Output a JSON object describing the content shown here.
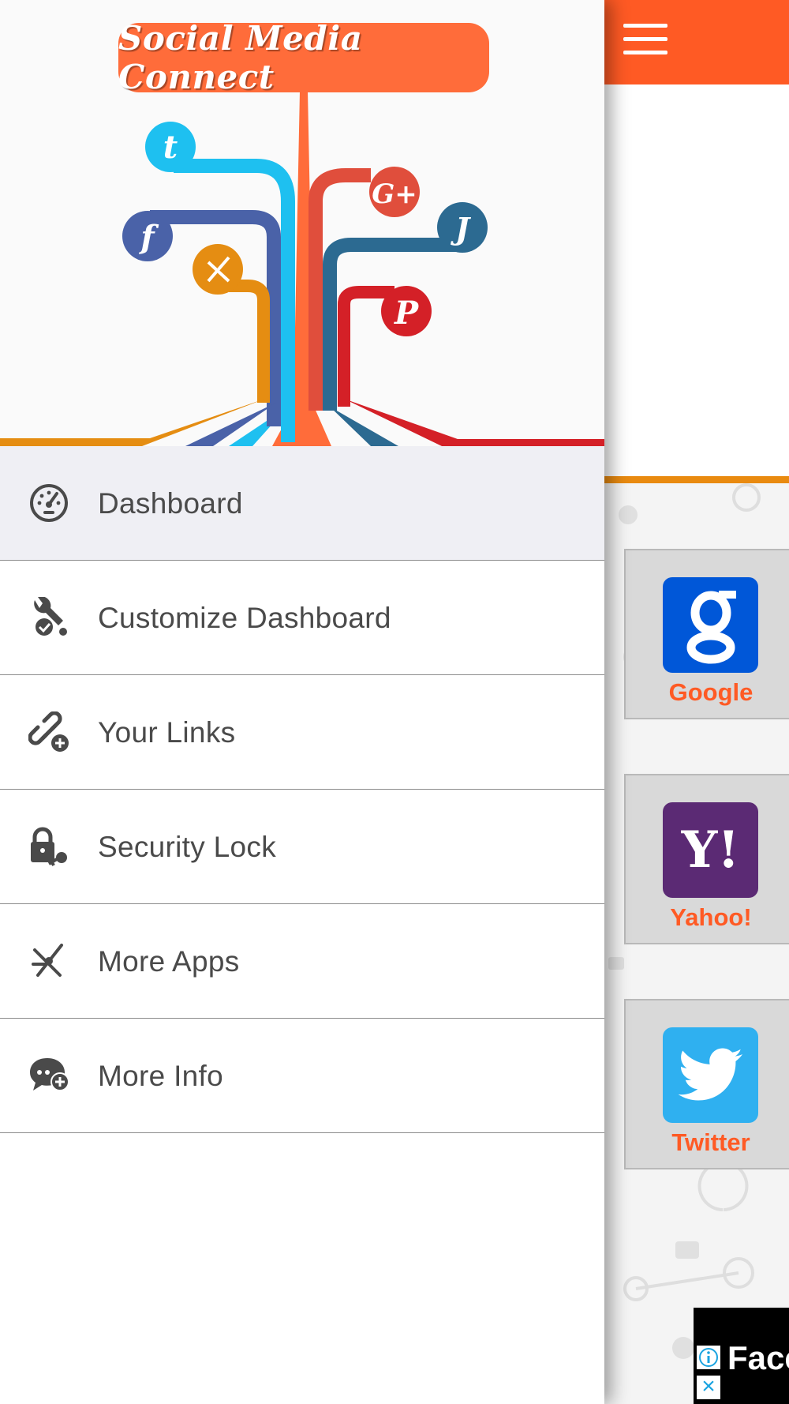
{
  "app": {
    "title": "Social Media Connect",
    "brand_color": "#ff5a24",
    "accent_color": "#e98a10"
  },
  "drawer": {
    "items": [
      {
        "label": "Dashboard",
        "icon": "speedometer-icon",
        "active": true
      },
      {
        "label": "Customize Dashboard",
        "icon": "wrench-check-icon",
        "active": false
      },
      {
        "label": "Your Links",
        "icon": "link-add-icon",
        "active": false
      },
      {
        "label": "Security Lock",
        "icon": "lock-key-icon",
        "active": false
      },
      {
        "label": "More Apps",
        "icon": "compass-star-icon",
        "active": false
      },
      {
        "label": "More Info",
        "icon": "chat-bubble-add-icon",
        "active": false
      }
    ]
  },
  "main": {
    "menu_icon": "hamburger-menu-icon",
    "services": [
      {
        "label": "Google",
        "icon": "google-logo-icon",
        "color": "#0057d8"
      },
      {
        "label": "Yahoo!",
        "icon": "yahoo-logo-icon",
        "color": "#5b2a74"
      },
      {
        "label": "Twitter",
        "icon": "twitter-bird-icon",
        "color": "#2fb0f0"
      }
    ]
  },
  "ad": {
    "text": "Face",
    "info_icon": "info-icon",
    "close_icon": "close-icon"
  }
}
